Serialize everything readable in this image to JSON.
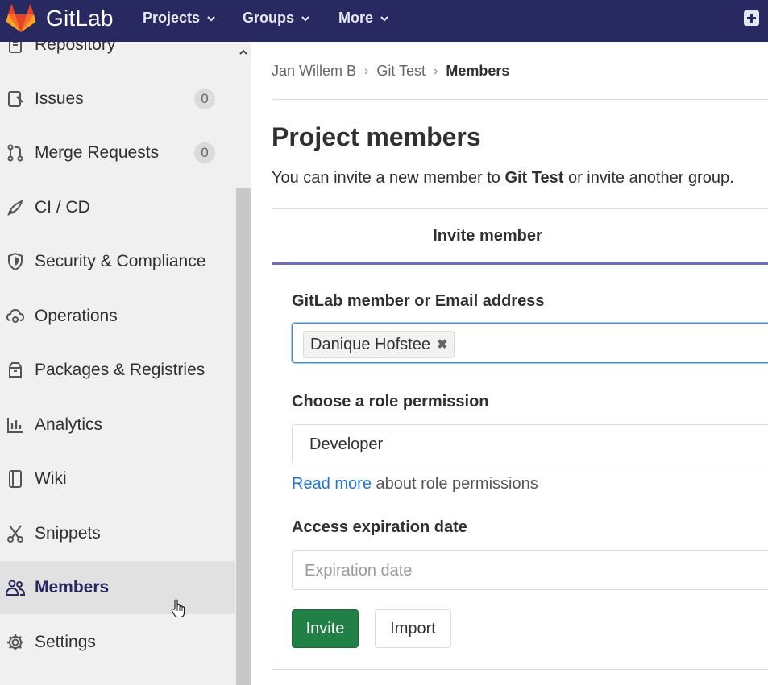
{
  "topbar": {
    "brand": "GitLab",
    "nav": [
      {
        "label": "Projects",
        "icon": "chevron-down-icon"
      },
      {
        "label": "Groups",
        "icon": "chevron-down-icon"
      },
      {
        "label": "More",
        "icon": "chevron-down-icon"
      }
    ],
    "new_icon": "plus-square-icon"
  },
  "sidebar": {
    "items": [
      {
        "label": "Repository",
        "icon": "doc-icon"
      },
      {
        "label": "Issues",
        "icon": "issues-icon",
        "badge": "0"
      },
      {
        "label": "Merge Requests",
        "icon": "merge-request-icon",
        "badge": "0"
      },
      {
        "label": "CI / CD",
        "icon": "rocket-icon"
      },
      {
        "label": "Security & Compliance",
        "icon": "shield-icon"
      },
      {
        "label": "Operations",
        "icon": "cloud-gear-icon"
      },
      {
        "label": "Packages & Registries",
        "icon": "package-icon"
      },
      {
        "label": "Analytics",
        "icon": "chart-icon"
      },
      {
        "label": "Wiki",
        "icon": "book-icon"
      },
      {
        "label": "Snippets",
        "icon": "scissors-icon"
      },
      {
        "label": "Members",
        "icon": "users-icon",
        "active": true
      },
      {
        "label": "Settings",
        "icon": "gear-icon"
      }
    ]
  },
  "breadcrumb": [
    "Jan Willem B",
    "Git Test",
    "Members"
  ],
  "page": {
    "title": "Project members",
    "intro_prefix": "You can invite a new member to ",
    "intro_project": "Git Test",
    "intro_suffix": " or invite another group."
  },
  "invite": {
    "tab_label": "Invite member",
    "member_label": "GitLab member or Email address",
    "member_token": "Danique Hofstee",
    "role_label": "Choose a role permission",
    "role_value": "Developer",
    "help_link": "Read more",
    "help_text": " about role permissions",
    "expiration_label": "Access expiration date",
    "expiration_placeholder": "Expiration date",
    "invite_button": "Invite",
    "import_button": "Import"
  }
}
